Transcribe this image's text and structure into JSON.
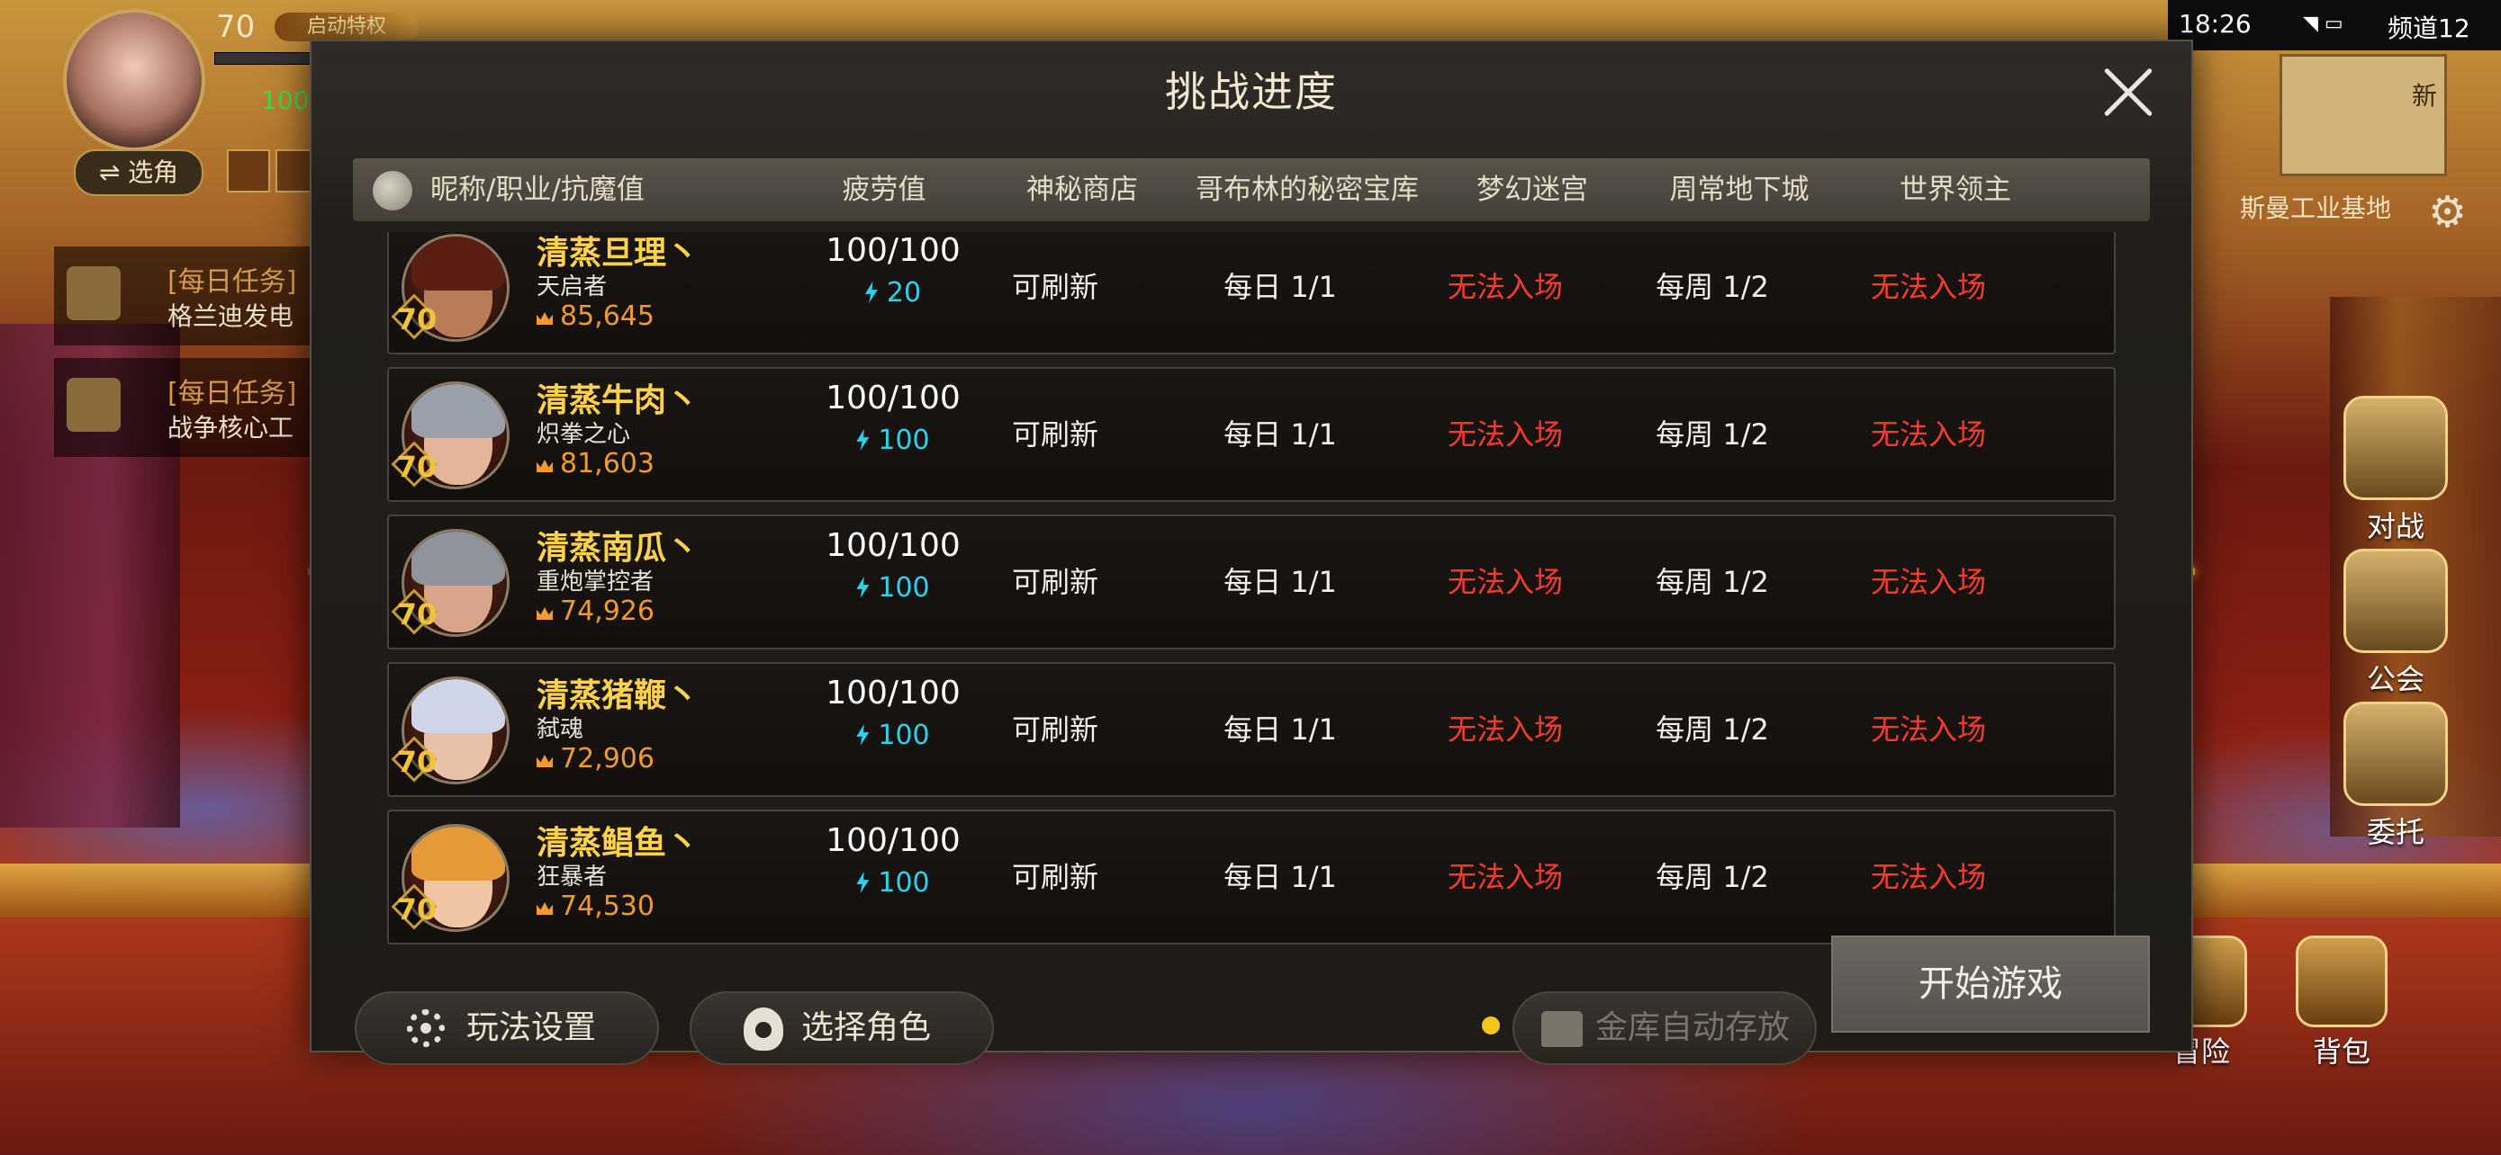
{
  "hud": {
    "level": "70",
    "gold_tag": "启动特权",
    "green_value": "100",
    "select_role": "⇌ 选角",
    "quests": [
      {
        "title": "[每日任务]",
        "subtitle": "格兰迪发电"
      },
      {
        "title": "[每日任务]",
        "subtitle": "战争核心工"
      }
    ],
    "status_time": "18:26",
    "channel": "频道12",
    "minimap_label": "新",
    "zone": "斯曼工业基地"
  },
  "side_buttons": [
    "对战",
    "公会",
    "委托"
  ],
  "bottom_buttons": [
    "冒险",
    "背包"
  ],
  "modal": {
    "title": "挑战进度",
    "headers": {
      "name": "昵称/职业/抗魔值",
      "fatigue": "疲劳值",
      "shop": "神秘商店",
      "goblin": "哥布林的秘密宝库",
      "maze": "梦幻迷宫",
      "dungeon": "周常地下城",
      "boss": "世界领主"
    },
    "rows": [
      {
        "level": "70",
        "name": "清蒸旦理丶",
        "class": "天启者",
        "power": "85,645",
        "fatigue": "100/100",
        "energy": "20",
        "shop": "可刷新",
        "goblin": "每日 1/1",
        "maze": "无法入场",
        "dungeon": "每周 1/2",
        "boss": "无法入场"
      },
      {
        "level": "70",
        "name": "清蒸牛肉丶",
        "class": "炽拳之心",
        "power": "81,603",
        "fatigue": "100/100",
        "energy": "100",
        "shop": "可刷新",
        "goblin": "每日 1/1",
        "maze": "无法入场",
        "dungeon": "每周 1/2",
        "boss": "无法入场"
      },
      {
        "level": "70",
        "name": "清蒸南瓜丶",
        "class": "重炮掌控者",
        "power": "74,926",
        "fatigue": "100/100",
        "energy": "100",
        "shop": "可刷新",
        "goblin": "每日 1/1",
        "maze": "无法入场",
        "dungeon": "每周 1/2",
        "boss": "无法入场"
      },
      {
        "level": "70",
        "name": "清蒸猪鞭丶",
        "class": "弑魂",
        "power": "72,906",
        "fatigue": "100/100",
        "energy": "100",
        "shop": "可刷新",
        "goblin": "每日 1/1",
        "maze": "无法入场",
        "dungeon": "每周 1/2",
        "boss": "无法入场"
      },
      {
        "level": "70",
        "name": "清蒸鲳鱼丶",
        "class": "狂暴者",
        "power": "74,530",
        "fatigue": "100/100",
        "energy": "100",
        "shop": "可刷新",
        "goblin": "每日 1/1",
        "maze": "无法入场",
        "dungeon": "每周 1/2",
        "boss": "无法入场"
      }
    ],
    "buttons": {
      "settings": "玩法设置",
      "select_role": "选择角色",
      "vault": "金库自动存放",
      "start": "开始游戏"
    },
    "page_dots": {
      "total": 2,
      "current": 1
    }
  },
  "colors": {
    "name_gold": "#ffd24a",
    "power_orange": "#f19b2e",
    "energy_cyan": "#2fd0ee",
    "deny_red": "#ff3b2e",
    "dot_active": "#f5c518",
    "dot_inactive": "#6a655e"
  }
}
